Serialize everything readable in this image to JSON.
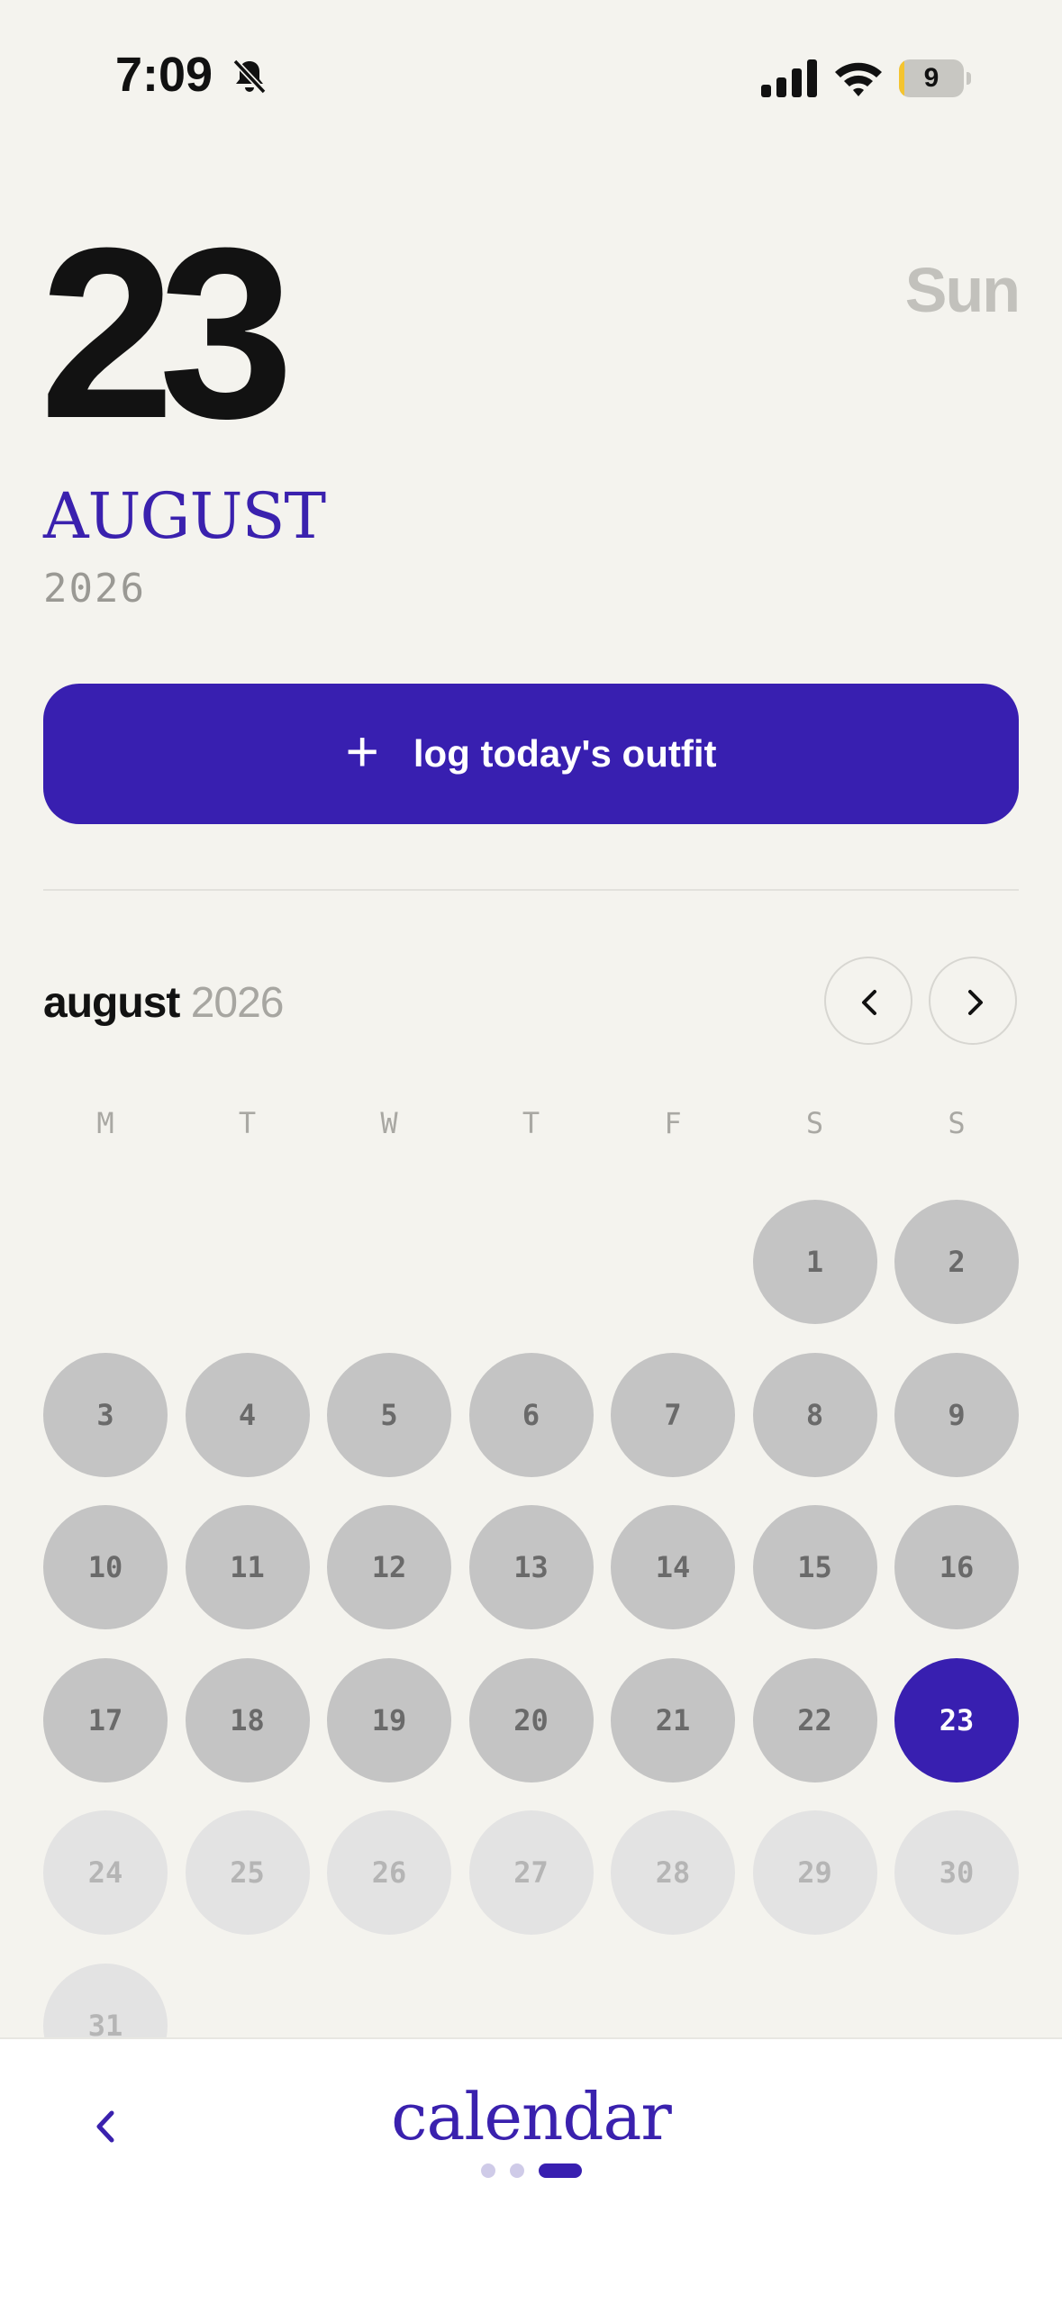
{
  "status_bar": {
    "time": "7:09",
    "battery": "9",
    "battery_level": 0.09
  },
  "header": {
    "day_number": "23",
    "weekday": "Sun",
    "month": "AUGUST",
    "year": "2026"
  },
  "log_button": {
    "label": "log today's outfit"
  },
  "calendar": {
    "month": "august",
    "year": "2026",
    "weekday_labels": [
      "M",
      "T",
      "W",
      "T",
      "F",
      "S",
      "S"
    ],
    "first_weekday_index": 5,
    "days_in_month": 31,
    "today": 23
  },
  "bottom_nav": {
    "title": "calendar",
    "page_count": 3,
    "active_page": 2
  },
  "colors": {
    "accent": "#381fb0",
    "past_day": "#c4c4c4",
    "future_day": "#e3e3e3"
  }
}
